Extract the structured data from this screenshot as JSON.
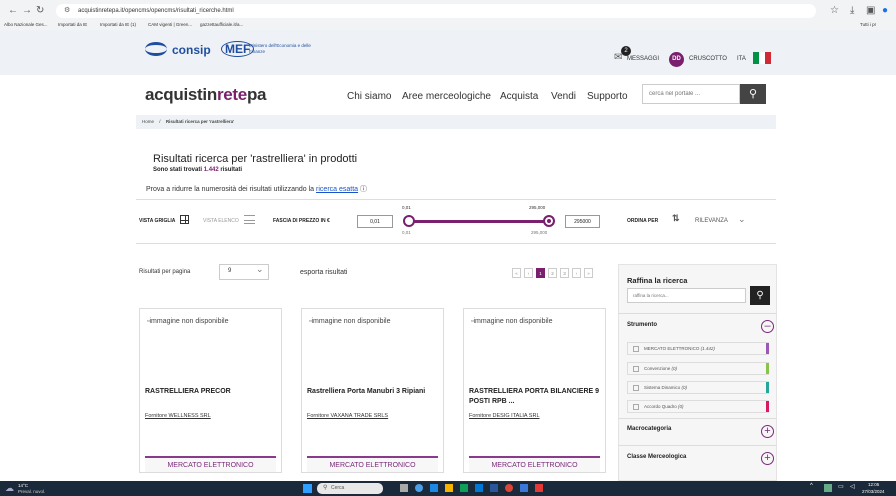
{
  "browser": {
    "url": "acquistinretepa.it/opencms/opencms/risultati_ricerche.html",
    "bookmarks": [
      "Albo Nazionale Ges...",
      "Importati da IE",
      "Importati da IE (1)",
      "CAM vigenti | Green...",
      "gazzettaufficiale.it/a...",
      "Tutti i pr"
    ]
  },
  "header": {
    "consip": "consip",
    "mef": "MEF",
    "mef_sub": "Ministero dell'Economia e delle Finanze",
    "messages_label": "MESSAGGI",
    "messages_count": "2",
    "avatar": "DD",
    "dashboard_label": "CRUSCOTTO",
    "lang": "ITA"
  },
  "nav": {
    "logo_a": "acquistin",
    "logo_b": "rete",
    "logo_c": "pa",
    "items": [
      "Chi siamo",
      "Aree merceologiche",
      "Acquista",
      "Vendi",
      "Supporto"
    ],
    "search_placeholder": "cerca nel portale ..."
  },
  "breadcrumb": {
    "home": "Home",
    "sep": "/",
    "current": "Risultati ricerca per 'rastrelliera'"
  },
  "results": {
    "title": "Risultati ricerca per 'rastrelliera' in prodotti",
    "count_prefix": "Sono stati trovati",
    "count": "1.442",
    "count_suffix": "risultati",
    "hint_prefix": "Prova a ridurre la numerosità dei risultati utilizzando la",
    "hint_link": "ricerca esatta",
    "info_icon": "ⓘ"
  },
  "toolbar": {
    "grid_view": "VISTA GRIGLIA",
    "list_view": "VISTA ELENCO",
    "price_label": "FASCIA DI PREZZO IN €",
    "price_min": "0,01",
    "price_max": "295000",
    "slider_min_top": "0,01",
    "slider_max_top": "295,000",
    "slider_min_bottom": "0,01",
    "slider_max_bottom": "295,000",
    "sort_label": "ORDINA PER",
    "sort_value": "RILEVANZA"
  },
  "list_controls": {
    "per_page_label": "Risultati per pagina",
    "per_page_value": "9",
    "export": "esporta risultati",
    "pages": [
      "«",
      "‹",
      "1",
      "2",
      "3",
      "›",
      "»"
    ]
  },
  "cards": [
    {
      "image_alt": "immagine non disponibile",
      "title": "RASTRELLIERA PRECOR",
      "supplier": "Fornitore WELLNESS SRL",
      "button": "MERCATO ELETTRONICO"
    },
    {
      "image_alt": "immagine non disponibile",
      "title": "Rastrelliera Porta Manubri 3 Ripiani",
      "supplier": "Fornitore VAXANA TRADE SRLS",
      "button": "MERCATO ELETTRONICO"
    },
    {
      "image_alt": "immagine non disponibile",
      "title": "RASTRELLIERA PORTA BILANCIERE 9 POSTI RPB ...",
      "supplier": "Fornitore DESIG ITALIA SRL",
      "button": "MERCATO ELETTRONICO"
    }
  ],
  "refine": {
    "title": "Raffina la ricerca",
    "placeholder": "raffina la ricerca...",
    "strumento": "Strumento",
    "options": [
      {
        "label": "MERCATO ELETTRONICO",
        "count": "(1.442)",
        "color": "#9b59b6"
      },
      {
        "label": "Convenzione",
        "count": "(0)",
        "color": "#8bc34a"
      },
      {
        "label": "Sistema Dinamico",
        "count": "(0)",
        "color": "#26a69a"
      },
      {
        "label": "Accordo Quadro",
        "count": "(0)",
        "color": "#d81b60"
      }
    ],
    "macro": "Macrocategoria",
    "classe": "Classe Merceologica"
  },
  "taskbar": {
    "weather_temp": "14°C",
    "weather_desc": "Preval. nuvol.",
    "search": "Cerca",
    "time": "12:05",
    "date": "27/03/2024"
  }
}
